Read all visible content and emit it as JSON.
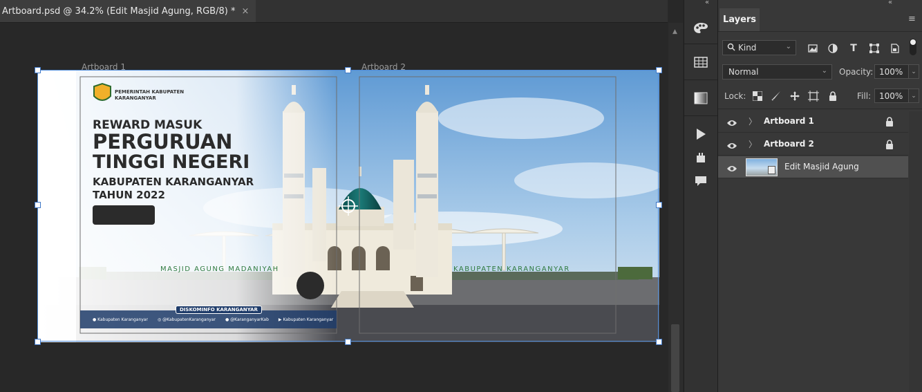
{
  "document": {
    "tab_title": "Artboard.psd @ 34.2% (Edit Masjid Agung, RGB/8) *",
    "close_glyph": "×"
  },
  "canvas": {
    "artboard_labels": [
      "Artboard 1",
      "Artboard 2"
    ],
    "artwork": {
      "logo_text_line1": "PEMERINTAH KABUPATEN",
      "logo_text_line2": "KARANGANYAR",
      "headline_small": "REWARD MASUK",
      "headline_big_line1": "PERGURUAN",
      "headline_big_line2": "TINGGI NEGERI",
      "subhead_line1": "KABUPATEN KARANGANYAR",
      "subhead_line2": "TAHUN 2022",
      "mosque_sign_left": "MASJID AGUNG MADANIYAH",
      "mosque_sign_right": "KABUPATEN KARANGANYAR",
      "footer_badge": "DISKOMINFO KARANGANYAR",
      "socials": [
        {
          "icon": "facebook-icon",
          "text": "Kabupaten Karanganyar"
        },
        {
          "icon": "instagram-icon",
          "text": "@KabupatenKaranganyar"
        },
        {
          "icon": "twitter-icon",
          "text": "@KaranganyarKab"
        },
        {
          "icon": "youtube-icon",
          "text": "Kabupaten Karanganyar"
        }
      ]
    }
  },
  "layers_panel": {
    "tab_label": "Layers",
    "filter_kind": "Kind",
    "blend_mode": "Normal",
    "opacity_label": "Opacity:",
    "opacity_value": "100%",
    "lock_label": "Lock:",
    "fill_label": "Fill:",
    "fill_value": "100%",
    "layers": [
      {
        "name": "Artboard 1",
        "type": "artboard",
        "locked": true,
        "selected": false
      },
      {
        "name": "Artboard 2",
        "type": "artboard",
        "locked": true,
        "selected": false
      },
      {
        "name": "Edit Masjid Agung",
        "type": "smart-object",
        "locked": false,
        "selected": true
      }
    ]
  },
  "colors": {
    "accent_selection": "#4f8bd8",
    "canvas_bg": "#282828",
    "panel_bg": "#383838"
  }
}
